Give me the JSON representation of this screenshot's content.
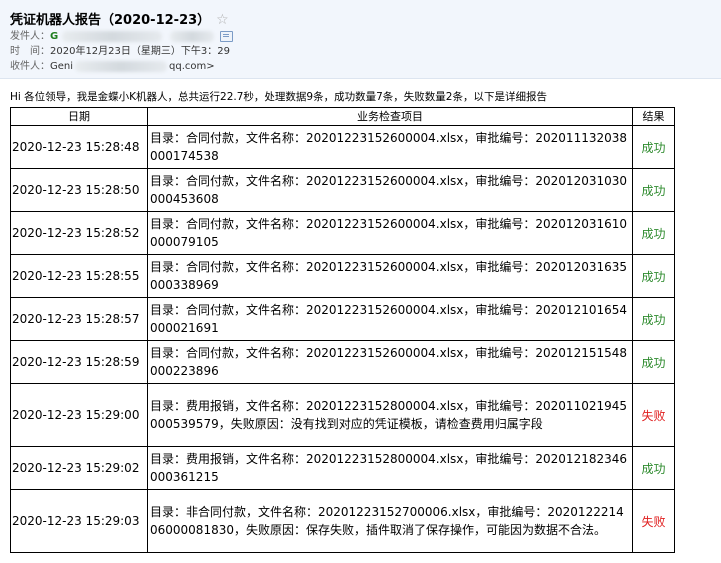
{
  "email": {
    "subject": "凭证机器人报告（2020-12-23）",
    "star_glyph": "☆",
    "from_label": "发件人：",
    "from_name": "G",
    "time_label": "时　间：",
    "time_value": "2020年12月23日（星期三）下午3：29",
    "to_label": "收件人：",
    "to_name": "Geni",
    "to_suffix": "qq.com>"
  },
  "intro": "Hi 各位领导，我是金蝶小K机器人，总共运行22.7秒，处理数据9条，成功数量7条，失败数量2条，以下是详细报告",
  "table": {
    "headers": [
      "日期",
      "业务检查项目",
      "结果"
    ],
    "rows": [
      {
        "date": "2020-12-23 15:28:48",
        "item": "目录：合同付款，文件名称：20201223152600004.xlsx，审批编号：202011132038000174538",
        "result": "成功",
        "status": "ok"
      },
      {
        "date": "2020-12-23 15:28:50",
        "item": "目录：合同付款，文件名称：20201223152600004.xlsx，审批编号：202012031030000453608",
        "result": "成功",
        "status": "ok"
      },
      {
        "date": "2020-12-23 15:28:52",
        "item": "目录：合同付款，文件名称：20201223152600004.xlsx，审批编号：202012031610000079105",
        "result": "成功",
        "status": "ok"
      },
      {
        "date": "2020-12-23 15:28:55",
        "item": "目录：合同付款，文件名称：20201223152600004.xlsx，审批编号：202012031635000338969",
        "result": "成功",
        "status": "ok"
      },
      {
        "date": "2020-12-23 15:28:57",
        "item": "目录：合同付款，文件名称：20201223152600004.xlsx，审批编号：202012101654000021691",
        "result": "成功",
        "status": "ok"
      },
      {
        "date": "2020-12-23 15:28:59",
        "item": "目录：合同付款，文件名称：20201223152600004.xlsx，审批编号：202012151548000223896",
        "result": "成功",
        "status": "ok"
      },
      {
        "date": "2020-12-23 15:29:00",
        "item": "目录：费用报销，文件名称：20201223152800004.xlsx，审批编号：202011021945000539579，失败原因：没有找到对应的凭证模板，请检查费用归属字段",
        "result": "失败",
        "status": "fail"
      },
      {
        "date": "2020-12-23 15:29:02",
        "item": "目录：费用报销，文件名称：20201223152800004.xlsx，审批编号：202012182346000361215",
        "result": "成功",
        "status": "ok"
      },
      {
        "date": "2020-12-23 15:29:03",
        "item": "目录：非合同付款，文件名称：20201223152700006.xlsx，审批编号：202012221406000081830，失败原因：保存失败，插件取消了保存操作，可能因为数据不合法。",
        "result": "失败",
        "status": "fail"
      }
    ]
  },
  "colors": {
    "success": "#2e8b2e",
    "failure": "#e02020",
    "header_bg": "#f2f6fc"
  },
  "icons": {
    "favorite": "star-icon",
    "contact_card": "contact-card-icon"
  }
}
